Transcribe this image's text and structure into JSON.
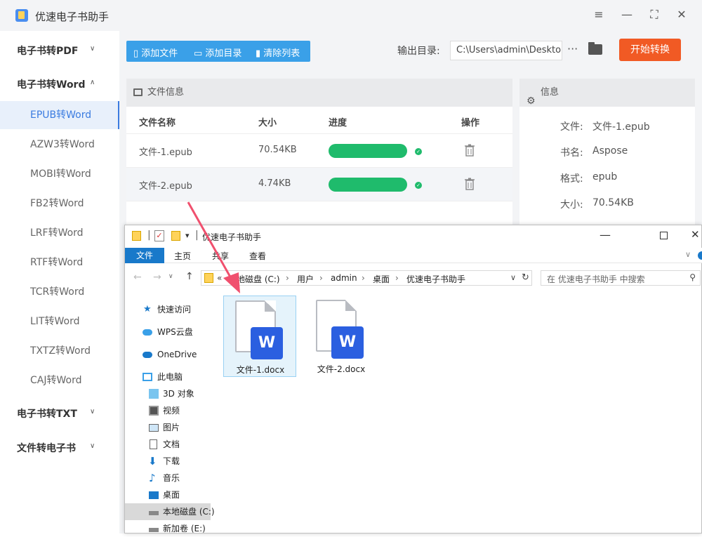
{
  "app": {
    "title": "优速电子书助手"
  },
  "sidebar": {
    "groups": [
      {
        "label": "电子书转PDF",
        "caret": "∨"
      },
      {
        "label": "电子书转Word",
        "caret": "∧"
      },
      {
        "label": "电子书转TXT",
        "caret": "∨"
      },
      {
        "label": "文件转电子书",
        "caret": "∨"
      }
    ],
    "items": [
      "EPUB转Word",
      "AZW3转Word",
      "MOBI转Word",
      "FB2转Word",
      "LRF转Word",
      "RTF转Word",
      "TCR转Word",
      "LIT转Word",
      "TXTZ转Word",
      "CAJ转Word"
    ]
  },
  "toolbar": {
    "add_file": "添加文件",
    "add_dir": "添加目录",
    "clear": "清除列表"
  },
  "output": {
    "label": "输出目录:",
    "path": "C:\\Users\\admin\\Deskto",
    "more": "···"
  },
  "start_button": "开始转换",
  "file_panel": {
    "title": "文件信息",
    "headers": {
      "name": "文件名称",
      "size": "大小",
      "progress": "进度",
      "action": "操作"
    },
    "rows": [
      {
        "name": "文件-1.epub",
        "size": "70.54KB",
        "progress": 1.0
      },
      {
        "name": "文件-2.epub",
        "size": "4.74KB",
        "progress": 1.0
      }
    ]
  },
  "info_panel": {
    "title": "信息",
    "fields": [
      {
        "label": "文件:",
        "value": "文件-1.epub"
      },
      {
        "label": "书名:",
        "value": "Aspose"
      },
      {
        "label": "格式:",
        "value": "epub"
      },
      {
        "label": "大小:",
        "value": "70.54KB"
      }
    ]
  },
  "explorer": {
    "title": "优速电子书助手",
    "ribbon": {
      "file": "文件",
      "home": "主页",
      "share": "共享",
      "view": "查看"
    },
    "address": {
      "root": "本地磁盘 (C:)",
      "p1": "用户",
      "p2": "admin",
      "p3": "桌面",
      "p4": "优速电子书助手"
    },
    "search_placeholder": "在 优速电子书助手 中搜索",
    "nav": [
      "快速访问",
      "WPS云盘",
      "OneDrive",
      "此电脑",
      "3D 对象",
      "视频",
      "图片",
      "文档",
      "下载",
      "音乐",
      "桌面",
      "本地磁盘 (C:)",
      "新加卷 (E:)"
    ],
    "files": [
      {
        "name": "文件-1.docx",
        "icon": "W"
      },
      {
        "name": "文件-2.docx",
        "icon": "W"
      }
    ]
  },
  "colors": {
    "accent": "#3aa0e8",
    "start": "#f15a24",
    "progress": "#1fbb6c",
    "word": "#2b5fe0",
    "arrow": "#f0506e"
  }
}
